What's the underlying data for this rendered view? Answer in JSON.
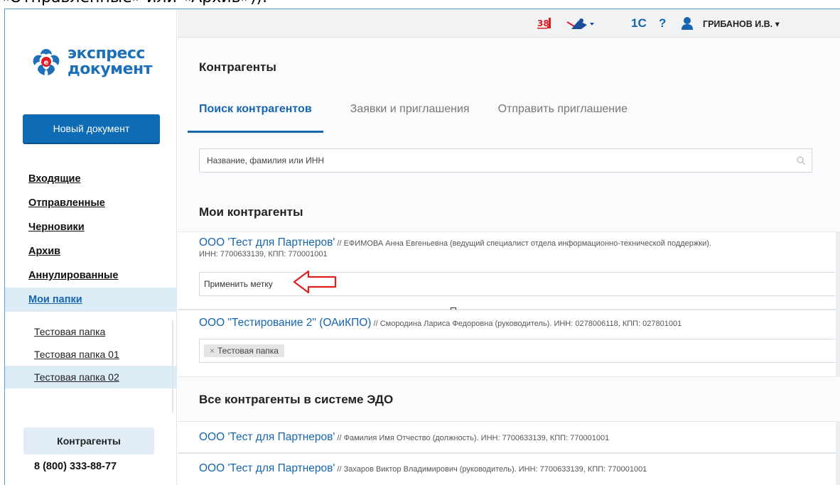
{
  "caption": "«Отправленные» или «Архив»)).",
  "brand": {
    "line1": "экспресс",
    "line2": "документ"
  },
  "sidebar": {
    "new_document": "Новый документ",
    "items": [
      {
        "label": "Входящие"
      },
      {
        "label": "Отправленные"
      },
      {
        "label": "Черновики"
      },
      {
        "label": "Архив"
      },
      {
        "label": "Аннулированные"
      },
      {
        "label": "Мои папки"
      }
    ],
    "folders": [
      {
        "label": "Тестовая папка"
      },
      {
        "label": "Тестовая папка 01"
      },
      {
        "label": "Тестовая папка 02"
      }
    ],
    "contacts_button": "Контрагенты",
    "phone": "8 (800) 333-88-77"
  },
  "header": {
    "notif_badge": "38",
    "app_1c": "1С",
    "help": "?",
    "user": "ГРИБАНОВ И.В. ▾"
  },
  "main": {
    "title": "Контрагенты",
    "tabs": [
      {
        "label": "Поиск контрагентов"
      },
      {
        "label": "Заявки и приглашения"
      },
      {
        "label": "Отправить приглашение"
      }
    ],
    "search_placeholder": "Название, фамилия или ИНН",
    "my_section": "Мои контрагенты",
    "my": [
      {
        "name": "ООО 'Тест для Партнеров'",
        "details": " // ЕФИМОВА Анна Евгеньевна (ведущий специалист отдела информационно-технической поддержки).",
        "ids": "ИНН: 7700633139, КПП: 770001001",
        "tag_placeholder": "Применить метку"
      },
      {
        "name": "ООО \"Тестирование 2\" (ОАиКПО)",
        "details": " // Смородина Лариса Федоровна (руководитель). ИНН: 0278006118, КПП: 027801001",
        "chip": "Тестовая папка",
        "chip_remove": "×"
      }
    ],
    "all_section": "Все контрагенты в системе ЭДО",
    "all": [
      {
        "name": "ООО 'Тест для Партнеров'",
        "details": " // Фамилия Имя Отчество (должность). ИНН: 7700633139, КПП: 770001001"
      },
      {
        "name": "ООО 'Тест для Партнеров'",
        "details": " // Захаров Виктор Владимирович (руководитель). ИНН: 7700633139, КПП: 770001001"
      }
    ]
  },
  "colors": {
    "accent": "#1565b0",
    "button": "#0e6bb5",
    "annotation_arrow": "#e02020"
  },
  "icons": [
    "calendar-icon",
    "mail-icon",
    "help-icon",
    "user-icon",
    "search-icon",
    "arrow-annotation-icon"
  ]
}
